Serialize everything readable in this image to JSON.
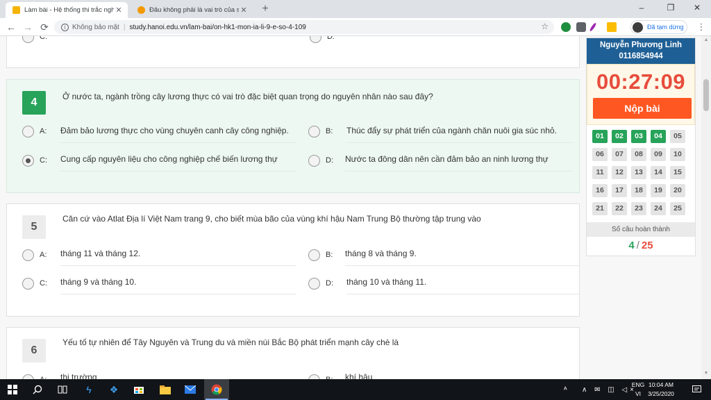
{
  "browser": {
    "tabs": [
      {
        "title": "Làm bài - Hệ thống thi trắc nghiệ",
        "active": true
      },
      {
        "title": "Đâu không phải là vai trò của sản",
        "active": false
      }
    ],
    "nav": {
      "back": "←",
      "forward": "→",
      "reload": "⟳"
    },
    "address": {
      "security": "Không bảo mật",
      "separator": "|",
      "url": "study.hanoi.edu.vn/lam-bai/on-hk1-mon-ia-li-9-e-so-4-109"
    },
    "profile_label": "Đã tạm dừng",
    "window_controls": {
      "minimize": "–",
      "maximize": "❐",
      "close": "✕"
    }
  },
  "questions": [
    {
      "partial_options": [
        {
          "letter": "C:",
          "text": ""
        },
        {
          "letter": "D:",
          "text": ""
        }
      ]
    },
    {
      "number": "4",
      "status": "done",
      "text": "Ở nước ta, ngành trồng cây lương thực có vai trò đặc biệt quan trọng do nguyên nhân nào sau đây?",
      "options": [
        {
          "letter": "A:",
          "text": "Đảm bảo lương thực cho vùng chuyên canh cây công nghiệp.",
          "selected": false
        },
        {
          "letter": "B:",
          "text": "Thúc đẩy sự phát triển của ngành chăn nuôi gia súc nhỏ.",
          "selected": false
        },
        {
          "letter": "C:",
          "text": "Cung cấp nguyên liệu cho công nghiệp chế biến lương thự",
          "selected": true
        },
        {
          "letter": "D:",
          "text": "Nước ta đông dân nên cần đảm bảo an ninh lương thự",
          "selected": false
        }
      ]
    },
    {
      "number": "5",
      "status": "todo",
      "text": "Căn cứ vào Atlat Địa lí Việt Nam trang 9, cho biết mùa bão của vùng khí hậu Nam Trung Bộ thường tập trung vào",
      "options": [
        {
          "letter": "A:",
          "text": "tháng 11 và tháng 12.",
          "selected": false
        },
        {
          "letter": "B:",
          "text": "tháng 8 và tháng 9.",
          "selected": false
        },
        {
          "letter": "C:",
          "text": "tháng 9 và tháng 10.",
          "selected": false
        },
        {
          "letter": "D:",
          "text": "tháng 10 và tháng 11.",
          "selected": false
        }
      ]
    },
    {
      "number": "6",
      "status": "todo",
      "text": "Yếu tố tự nhiên để Tây Nguyên và Trung du và miền núi Bắc Bộ phát triển mạnh cây chè là",
      "options": [
        {
          "letter": "A:",
          "text": "thị trường",
          "selected": false
        },
        {
          "letter": "B:",
          "text": "khí hậu",
          "selected": false
        }
      ]
    }
  ],
  "panel": {
    "student_name": "Nguyễn Phương Linh",
    "student_id": "0116854944",
    "timer": "00:27:09",
    "submit_label": "Nộp bài",
    "grid": [
      {
        "label": "01",
        "done": true
      },
      {
        "label": "02",
        "done": true
      },
      {
        "label": "03",
        "done": true
      },
      {
        "label": "04",
        "done": true
      },
      {
        "label": "05",
        "done": false
      },
      {
        "label": "06",
        "done": false
      },
      {
        "label": "07",
        "done": false
      },
      {
        "label": "08",
        "done": false
      },
      {
        "label": "09",
        "done": false
      },
      {
        "label": "10",
        "done": false
      },
      {
        "label": "11",
        "done": false
      },
      {
        "label": "12",
        "done": false
      },
      {
        "label": "13",
        "done": false
      },
      {
        "label": "14",
        "done": false
      },
      {
        "label": "15",
        "done": false
      },
      {
        "label": "16",
        "done": false
      },
      {
        "label": "17",
        "done": false
      },
      {
        "label": "18",
        "done": false
      },
      {
        "label": "19",
        "done": false
      },
      {
        "label": "20",
        "done": false
      },
      {
        "label": "21",
        "done": false
      },
      {
        "label": "22",
        "done": false
      },
      {
        "label": "23",
        "done": false
      },
      {
        "label": "24",
        "done": false
      },
      {
        "label": "25",
        "done": false
      }
    ],
    "completed_label": "Số câu hoàn thành",
    "completed": "4",
    "slash": "/",
    "total": "25"
  },
  "taskbar": {
    "lang_top": "ENG",
    "lang_bottom": "VI",
    "time": "10:04 AM",
    "date": "3/25/2020",
    "tray_text": "ᴬ",
    "tray_icons": "∧ ✉ ◫ ◁×"
  },
  "colors": {
    "accent_green": "#27a35a",
    "timer_red": "#e74c3c",
    "submit_orange": "#ff5722",
    "header_blue": "#1e5f95"
  }
}
